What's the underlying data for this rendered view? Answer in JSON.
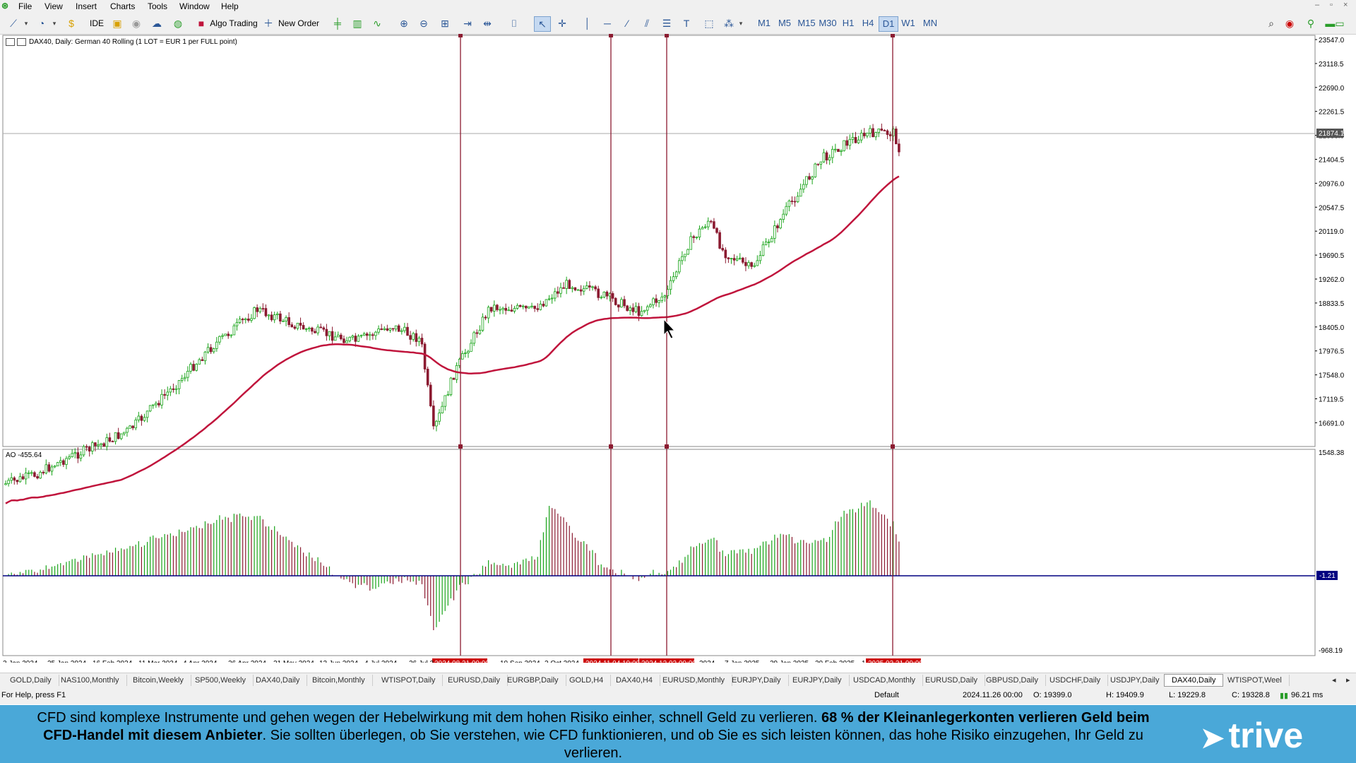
{
  "menu": {
    "items": [
      "File",
      "View",
      "Insert",
      "Charts",
      "Tools",
      "Window",
      "Help"
    ]
  },
  "toolbar": {
    "ide": "IDE",
    "algo_trading": "Algo Trading",
    "new_order": "New Order",
    "timeframes": [
      "M1",
      "M5",
      "M15",
      "M30",
      "H1",
      "H4",
      "D1",
      "W1",
      "MN"
    ],
    "active_timeframe": "D1"
  },
  "chart": {
    "header": "DAX40, Daily:  German 40 Rolling (1 LOT = EUR 1 per FULL point)",
    "price_labels": [
      "23547.0",
      "23118.5",
      "22690.0",
      "22261.5",
      "21833.0",
      "21404.5",
      "20976.0",
      "20547.5",
      "20119.0",
      "19690.5",
      "19262.0",
      "18833.5",
      "18405.0",
      "17976.5",
      "17548.0",
      "17119.5",
      "16691.0"
    ],
    "current_price": "21874.1",
    "ao_header": "AO -455.64",
    "ao_labels": [
      "1548.38",
      "-968.19"
    ],
    "ao_current": "-1.21",
    "date_labels": [
      "3 Jan 2024",
      "25 Jan 2024",
      "16 Feb 2024",
      "11 Mar 2024",
      "4 Apr 2024",
      "26 Apr 2024",
      "21 May 2024",
      "12 Jun 2024",
      "4 Jul 2024",
      "26 Jul 2",
      "10 Sep 2024",
      "2 Oct 2024",
      "2024",
      "7 Jan 2025",
      "29 Jan 2025",
      "20 Feb 2025",
      "1"
    ],
    "vline_labels": [
      "2024.08.21 00:00",
      "2024.11.04 19:00",
      "2024.12.02 00:00",
      "2025.03.31 00:00"
    ],
    "colors": {
      "bull": "#17a317",
      "bear": "#8b1a30",
      "ma": "#c0143c",
      "vline": "#8b1a30",
      "zero": "#000080"
    }
  },
  "tabs": [
    "GOLD,Daily",
    "NAS100,Monthly",
    "Bitcoin,Weekly",
    "SP500,Weekly",
    "DAX40,Daily",
    "Bitcoin,Monthly",
    "WTISPOT,Daily",
    "EURUSD,Daily",
    "EURGBP,Daily",
    "GOLD,H4",
    "DAX40,H4",
    "EURUSD,Monthly",
    "EURJPY,Daily",
    "EURJPY,Daily",
    "USDCAD,Monthly",
    "EURUSD,Daily",
    "GBPUSD,Daily",
    "USDCHF,Daily",
    "USDJPY,Daily",
    "DAX40,Daily",
    "WTISPOT,Weel"
  ],
  "active_tab_index": 19,
  "status": {
    "help": "For Help, press F1",
    "profile": "Default",
    "datetime": "2024.11.26 00:00",
    "open": "O: 19399.0",
    "high": "H: 19409.9",
    "low": "L: 19229.8",
    "close": "C: 19328.8",
    "ping": "96.21 ms"
  },
  "banner": {
    "text_a": "CFD sind komplexe Instrumente und gehen wegen der Hebelwirkung mit dem hohen Risiko einher, schnell Geld zu verlieren. ",
    "text_b": "68 % der Kleinanlegerkonten verlieren Geld beim CFD-Handel mit diesem Anbieter",
    "text_c": ". Sie sollten überlegen, ob Sie verstehen, wie CFD funktionieren, und ob Sie es sich leisten können, das hohe Risiko einzugehen, Ihr Geld zu verlieren.",
    "brand": "trive"
  }
}
